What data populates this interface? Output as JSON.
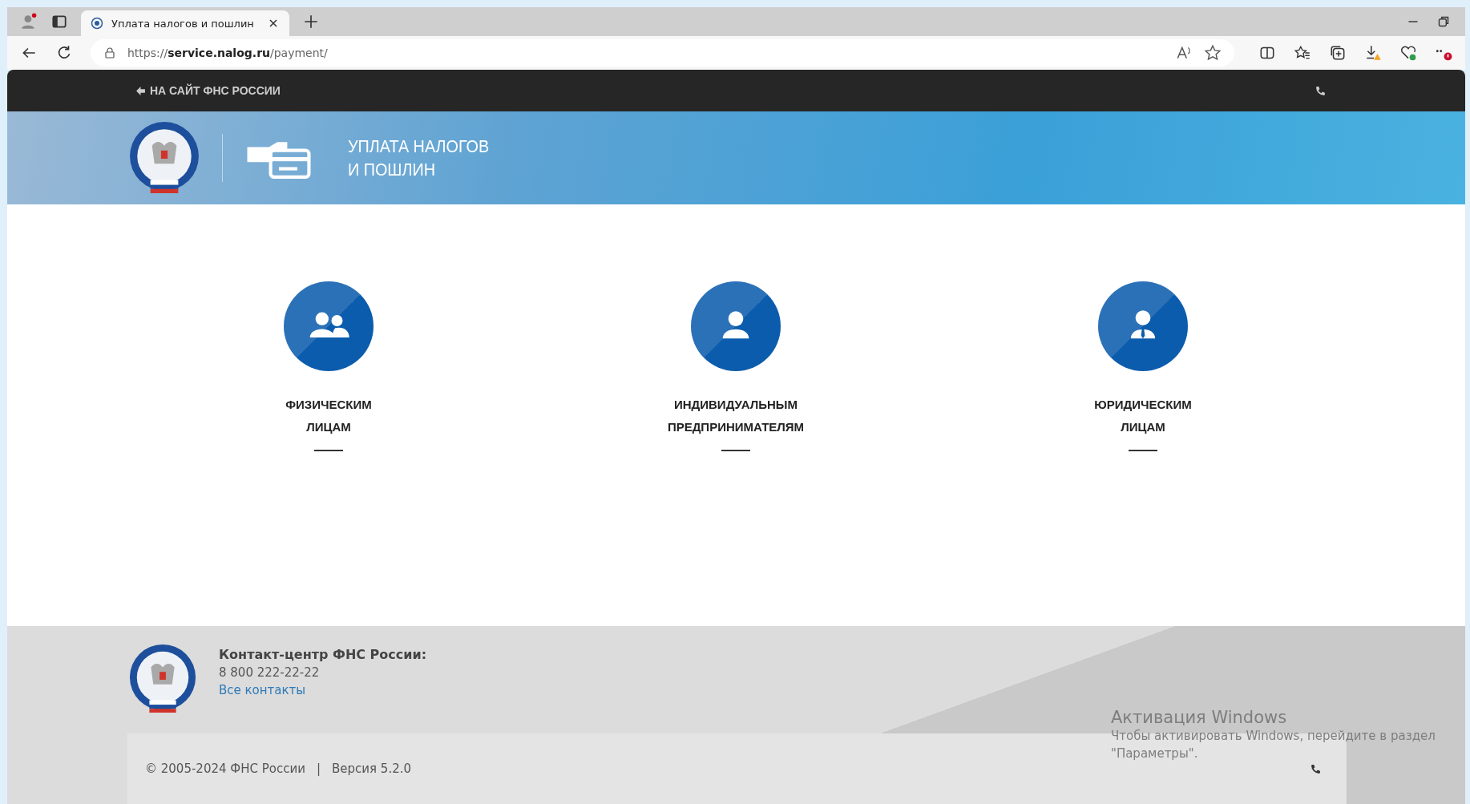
{
  "browser": {
    "tabs": [
      {
        "title": "Уплата налогов и пошлин",
        "selected": true
      }
    ],
    "url_scheme": "https://",
    "url_host": "service.nalog.ru",
    "url_path": "/payment/"
  },
  "topbar": {
    "back_link": "НА САЙТ ФНС РОССИИ"
  },
  "banner": {
    "title_lines": [
      "УПЛАТА НАЛОГОВ",
      "И ПОШЛИН"
    ]
  },
  "categories": [
    {
      "kind": "group",
      "lines": [
        "ФИЗИЧЕСКИМ",
        "ЛИЦАМ"
      ]
    },
    {
      "kind": "person",
      "lines": [
        "ИНДИВИДУАЛЬНЫМ",
        "ПРЕДПРИНИМАТЕЛЯМ"
      ]
    },
    {
      "kind": "business",
      "lines": [
        "ЮРИДИЧЕСКИМ",
        "ЛИЦАМ"
      ]
    }
  ],
  "footer": {
    "contact_title": "Контакт-центр ФНС России:",
    "phone": "8 800 222-22-22",
    "contacts_link": "Все контакты",
    "copyright": "© 2005-2024 ФНС России",
    "separator": "|",
    "version": "Версия 5.2.0"
  },
  "os_notice": {
    "title": "Активация Windows",
    "lines": [
      "Чтобы активировать Windows, перейдите в раздел",
      "\"Параметры\"."
    ]
  }
}
